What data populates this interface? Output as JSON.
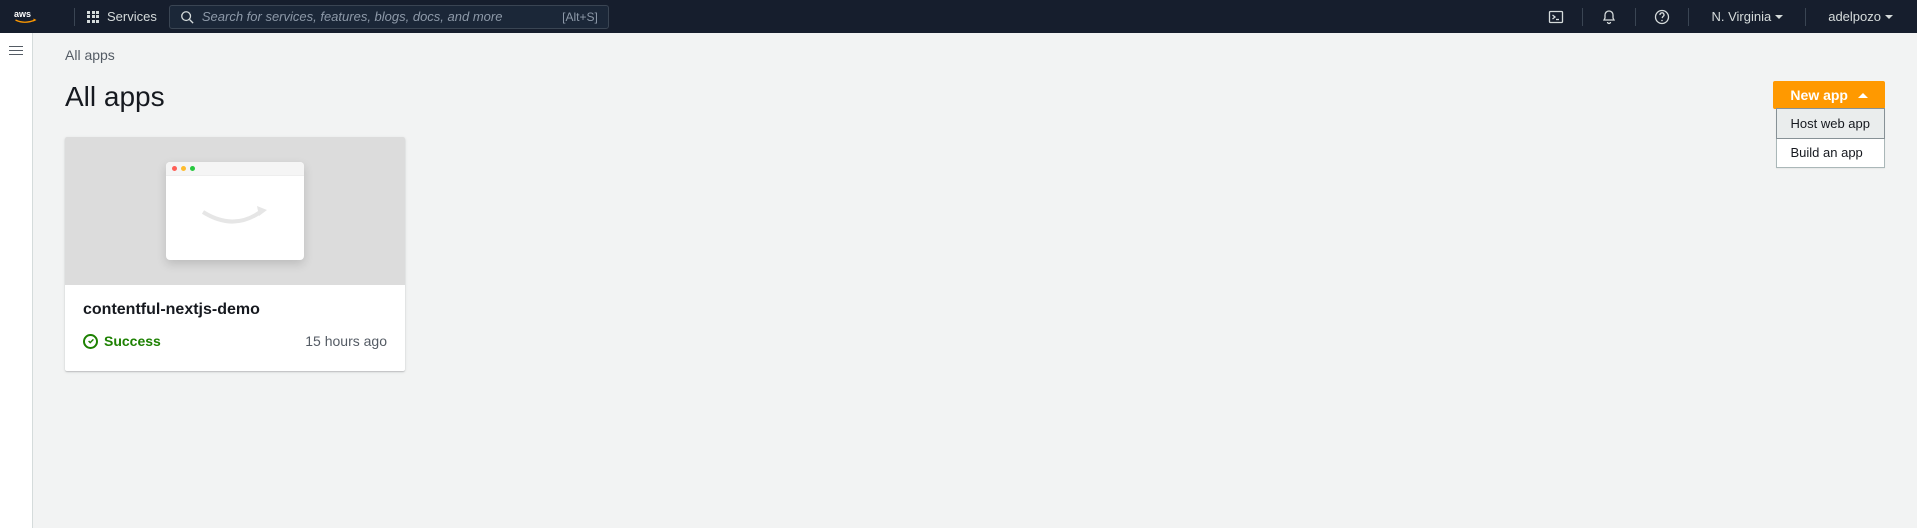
{
  "topnav": {
    "services_label": "Services",
    "search_placeholder": "Search for services, features, blogs, docs, and more",
    "search_hint": "[Alt+S]",
    "region": "N. Virginia",
    "account": "adelpozo"
  },
  "breadcrumb": "All apps",
  "page_title": "All apps",
  "new_app": {
    "button_label": "New app",
    "options": [
      {
        "label": "Host web app"
      },
      {
        "label": "Build an app"
      }
    ]
  },
  "apps": [
    {
      "name": "contentful-nextjs-demo",
      "status_label": "Success",
      "time_ago": "15 hours ago"
    }
  ]
}
